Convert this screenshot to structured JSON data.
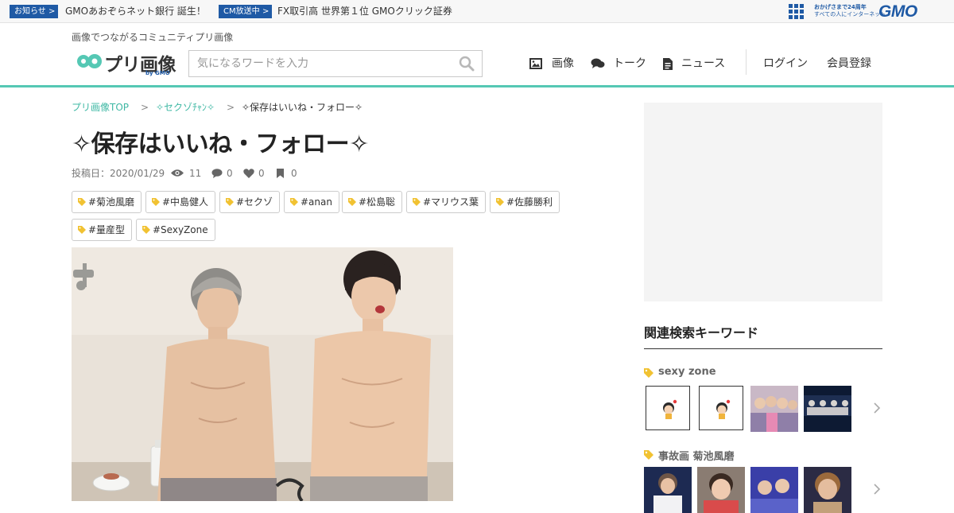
{
  "gmo_bar": {
    "notice_badge": "お知らせ",
    "notice_text": "GMOあおぞらネット銀行 誕生！",
    "cm_badge": "CM放送中",
    "cm_text": "FX取引高 世界第１位 GMOクリック証券",
    "tagline_line1": "おかげさまで24周年",
    "tagline_line2": "すべての人にインターネット",
    "logo_text": "GMO"
  },
  "header": {
    "tagline": "画像でつながるコミュニティプリ画像",
    "logo_text": "プリ画像",
    "logo_by": "by GMO",
    "search_placeholder": "気になるワードを入力",
    "nav": [
      {
        "label": "画像",
        "icon": "image-icon"
      },
      {
        "label": "トーク",
        "icon": "chat-bubbles-icon"
      },
      {
        "label": "ニュース",
        "icon": "document-icon"
      }
    ],
    "login_label": "ログイン",
    "register_label": "会員登録"
  },
  "breadcrumb": {
    "items": [
      "プリ画像TOP",
      "✧セクゾﾁｬﾝ✧",
      "✧保存はいいね・フォロー✧"
    ],
    "separator": ">"
  },
  "post": {
    "title": "✧保存はいいね・フォロー✧",
    "posted_label": "投稿日：2020/01/29",
    "views": "11",
    "comments": "0",
    "likes": "0",
    "saves": "0",
    "tags": [
      "#菊池風磨",
      "#中島健人",
      "#セクゾ",
      "#anan",
      "#松島聡",
      "#マリウス葉",
      "#佐藤勝利",
      "#量産型",
      "#SexyZone"
    ]
  },
  "sidebar": {
    "title": "関連検索キーワード",
    "keywords": [
      {
        "label": "sexy zone",
        "thumb_count": 4
      },
      {
        "label": "事故画 菊池風磨",
        "thumb_count": 4
      }
    ]
  },
  "colors": {
    "accent_teal": "#55c8b4",
    "link_teal": "#3fb8a4",
    "gmo_blue": "#1f5aa5",
    "tag_yellow": "#f1c232"
  }
}
